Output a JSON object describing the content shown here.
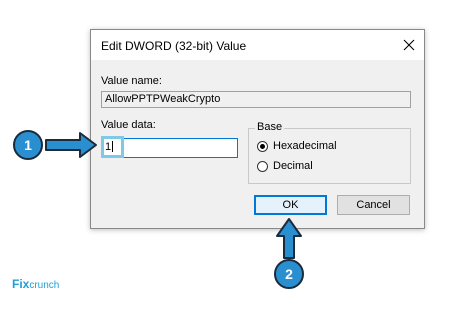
{
  "dialog": {
    "title": "Edit DWORD (32-bit) Value",
    "value_name_label": "Value name:",
    "value_name": "AllowPPTPWeakCrypto",
    "value_data_label": "Value data:",
    "value_data": "1",
    "base_label": "Base",
    "radio_hex_label": "Hexadecimal",
    "radio_hex_selected": true,
    "radio_dec_label": "Decimal",
    "radio_dec_selected": false,
    "ok_label": "OK",
    "cancel_label": "Cancel"
  },
  "annotations": {
    "step1": "1",
    "step2": "2",
    "color": "#2a8fd0"
  },
  "logo": {
    "prefix": "Fix",
    "suffix": "crunch"
  }
}
